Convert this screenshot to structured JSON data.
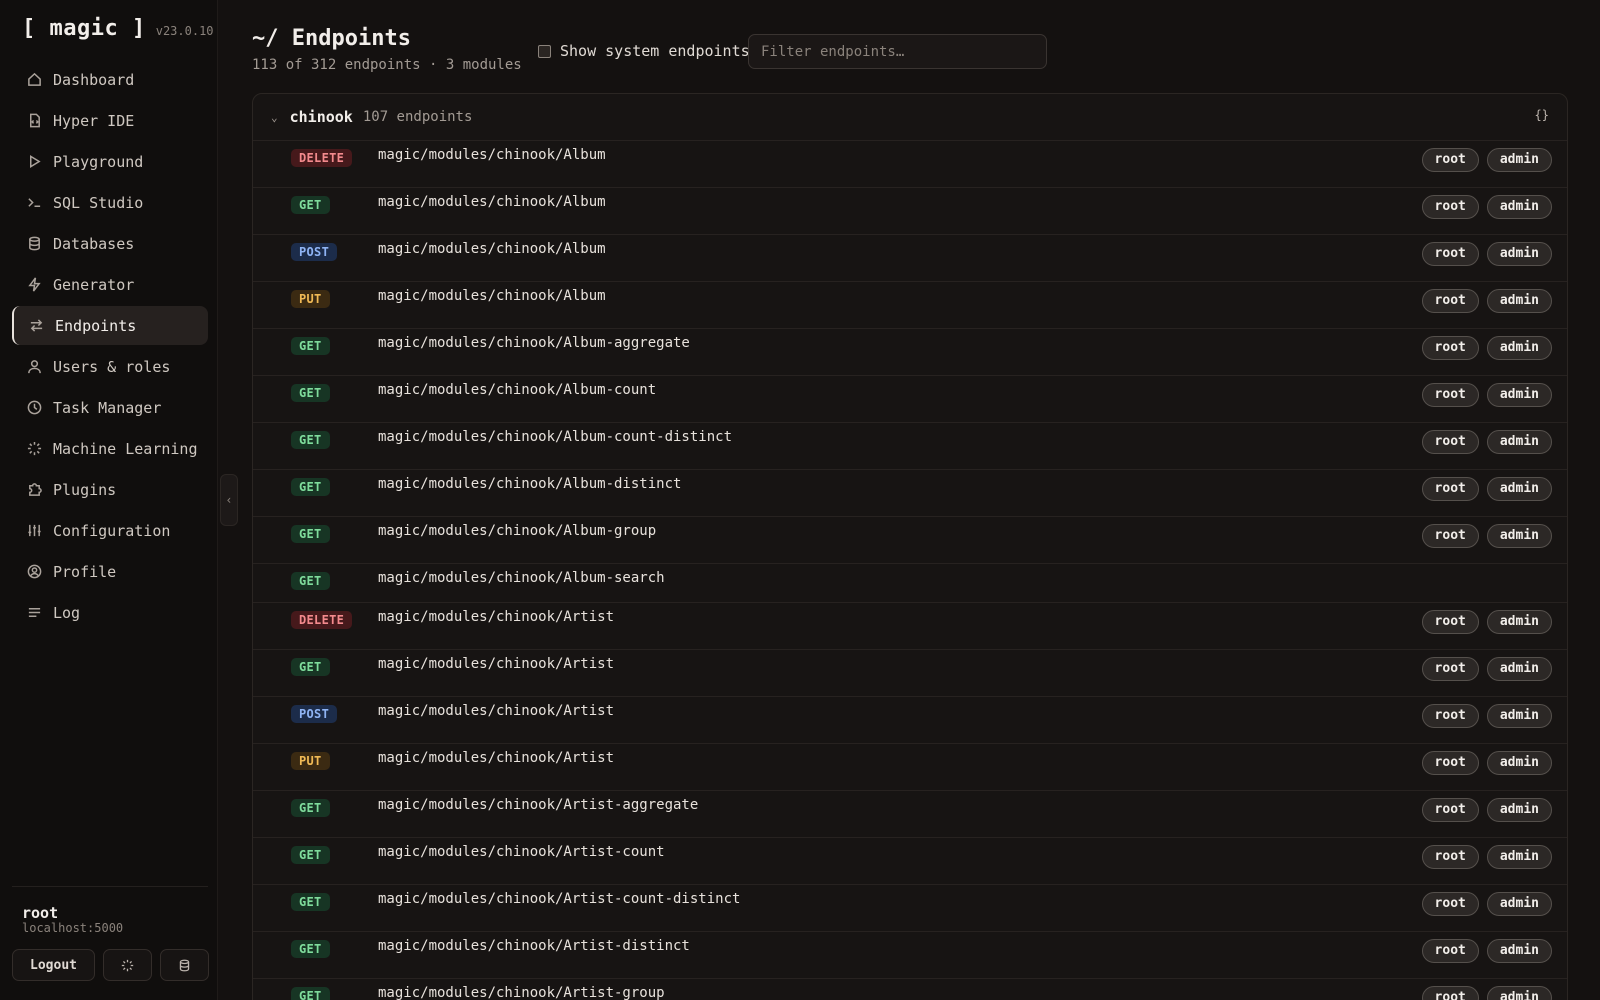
{
  "app": {
    "name": "[ magic ]",
    "version": "v23.0.10"
  },
  "sidebar": {
    "items": [
      {
        "label": "Dashboard",
        "icon": "home-icon",
        "active": false
      },
      {
        "label": "Hyper IDE",
        "icon": "file-code-icon",
        "active": false
      },
      {
        "label": "Playground",
        "icon": "play-icon",
        "active": false
      },
      {
        "label": "SQL Studio",
        "icon": "terminal-icon",
        "active": false
      },
      {
        "label": "Databases",
        "icon": "database-icon",
        "active": false
      },
      {
        "label": "Generator",
        "icon": "lightning-icon",
        "active": false
      },
      {
        "label": "Endpoints",
        "icon": "arrows-exchange-icon",
        "active": true
      },
      {
        "label": "Users & roles",
        "icon": "user-icon",
        "active": false
      },
      {
        "label": "Task Manager",
        "icon": "clock-icon",
        "active": false
      },
      {
        "label": "Machine Learning",
        "icon": "sparkle-loader-icon",
        "active": false
      },
      {
        "label": "Plugins",
        "icon": "puzzle-icon",
        "active": false
      },
      {
        "label": "Configuration",
        "icon": "sliders-icon",
        "active": false
      },
      {
        "label": "Profile",
        "icon": "user-circle-icon",
        "active": false
      },
      {
        "label": "Log",
        "icon": "list-lines-icon",
        "active": false
      }
    ],
    "user": {
      "name": "root",
      "host": "localhost:5000"
    },
    "logout_label": "Logout"
  },
  "header": {
    "title": "~/ Endpoints",
    "subtitle": "113 of 312 endpoints · 3 modules",
    "system_toggle_label": "Show system endpoints",
    "filter_placeholder": "Filter endpoints…"
  },
  "module": {
    "name": "chinook",
    "count": "107 endpoints",
    "toggle_json_label": "{}",
    "endpoints": [
      {
        "method": "DELETE",
        "path": "magic/modules/chinook/Album",
        "roles": [
          "root",
          "admin"
        ]
      },
      {
        "method": "GET",
        "path": "magic/modules/chinook/Album",
        "roles": [
          "root",
          "admin"
        ]
      },
      {
        "method": "POST",
        "path": "magic/modules/chinook/Album",
        "roles": [
          "root",
          "admin"
        ]
      },
      {
        "method": "PUT",
        "path": "magic/modules/chinook/Album",
        "roles": [
          "root",
          "admin"
        ]
      },
      {
        "method": "GET",
        "path": "magic/modules/chinook/Album-aggregate",
        "roles": [
          "root",
          "admin"
        ]
      },
      {
        "method": "GET",
        "path": "magic/modules/chinook/Album-count",
        "roles": [
          "root",
          "admin"
        ]
      },
      {
        "method": "GET",
        "path": "magic/modules/chinook/Album-count-distinct",
        "roles": [
          "root",
          "admin"
        ]
      },
      {
        "method": "GET",
        "path": "magic/modules/chinook/Album-distinct",
        "roles": [
          "root",
          "admin"
        ]
      },
      {
        "method": "GET",
        "path": "magic/modules/chinook/Album-group",
        "roles": [
          "root",
          "admin"
        ]
      },
      {
        "method": "GET",
        "path": "magic/modules/chinook/Album-search",
        "roles": []
      },
      {
        "method": "DELETE",
        "path": "magic/modules/chinook/Artist",
        "roles": [
          "root",
          "admin"
        ]
      },
      {
        "method": "GET",
        "path": "magic/modules/chinook/Artist",
        "roles": [
          "root",
          "admin"
        ]
      },
      {
        "method": "POST",
        "path": "magic/modules/chinook/Artist",
        "roles": [
          "root",
          "admin"
        ]
      },
      {
        "method": "PUT",
        "path": "magic/modules/chinook/Artist",
        "roles": [
          "root",
          "admin"
        ]
      },
      {
        "method": "GET",
        "path": "magic/modules/chinook/Artist-aggregate",
        "roles": [
          "root",
          "admin"
        ]
      },
      {
        "method": "GET",
        "path": "magic/modules/chinook/Artist-count",
        "roles": [
          "root",
          "admin"
        ]
      },
      {
        "method": "GET",
        "path": "magic/modules/chinook/Artist-count-distinct",
        "roles": [
          "root",
          "admin"
        ]
      },
      {
        "method": "GET",
        "path": "magic/modules/chinook/Artist-distinct",
        "roles": [
          "root",
          "admin"
        ]
      },
      {
        "method": "GET",
        "path": "magic/modules/chinook/Artist-group",
        "roles": [
          "root",
          "admin"
        ]
      }
    ]
  },
  "colors": {
    "background": "#141110",
    "get": "#7fdc9c",
    "post": "#8fb4f4",
    "put": "#f1ba55",
    "delete": "#f38a8d"
  }
}
